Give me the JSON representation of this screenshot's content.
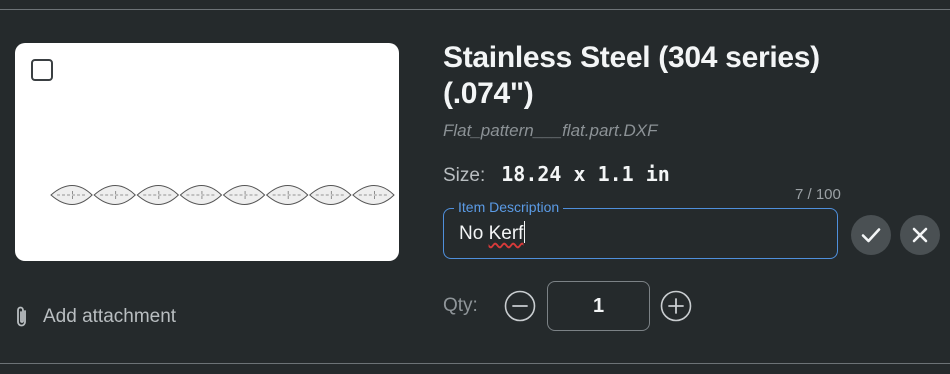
{
  "part": {
    "material_title": "Stainless Steel (304 series) (.074\")",
    "filename": "Flat_pattern___flat.part.DXF",
    "size_label": "Size:",
    "size_value": "18.24 x 1.1 in"
  },
  "preview": {
    "checkbox_checked": false,
    "pattern_segment_count": 8
  },
  "attachment": {
    "label": "Add attachment",
    "icon": "paperclip-icon"
  },
  "description": {
    "legend": "Item Description",
    "value": "No Kerf",
    "counter": "7 / 100",
    "value_prefix": "No ",
    "value_misspelled": "Kerf"
  },
  "actions": {
    "confirm_icon": "check-icon",
    "cancel_icon": "close-icon"
  },
  "quantity": {
    "label": "Qty:",
    "value": "1",
    "decrement_icon": "minus-circle-icon",
    "increment_icon": "plus-circle-icon"
  },
  "colors": {
    "background": "#252a2c",
    "accent_blue": "#4f8fdc",
    "spellcheck_red": "#d83a3a"
  }
}
